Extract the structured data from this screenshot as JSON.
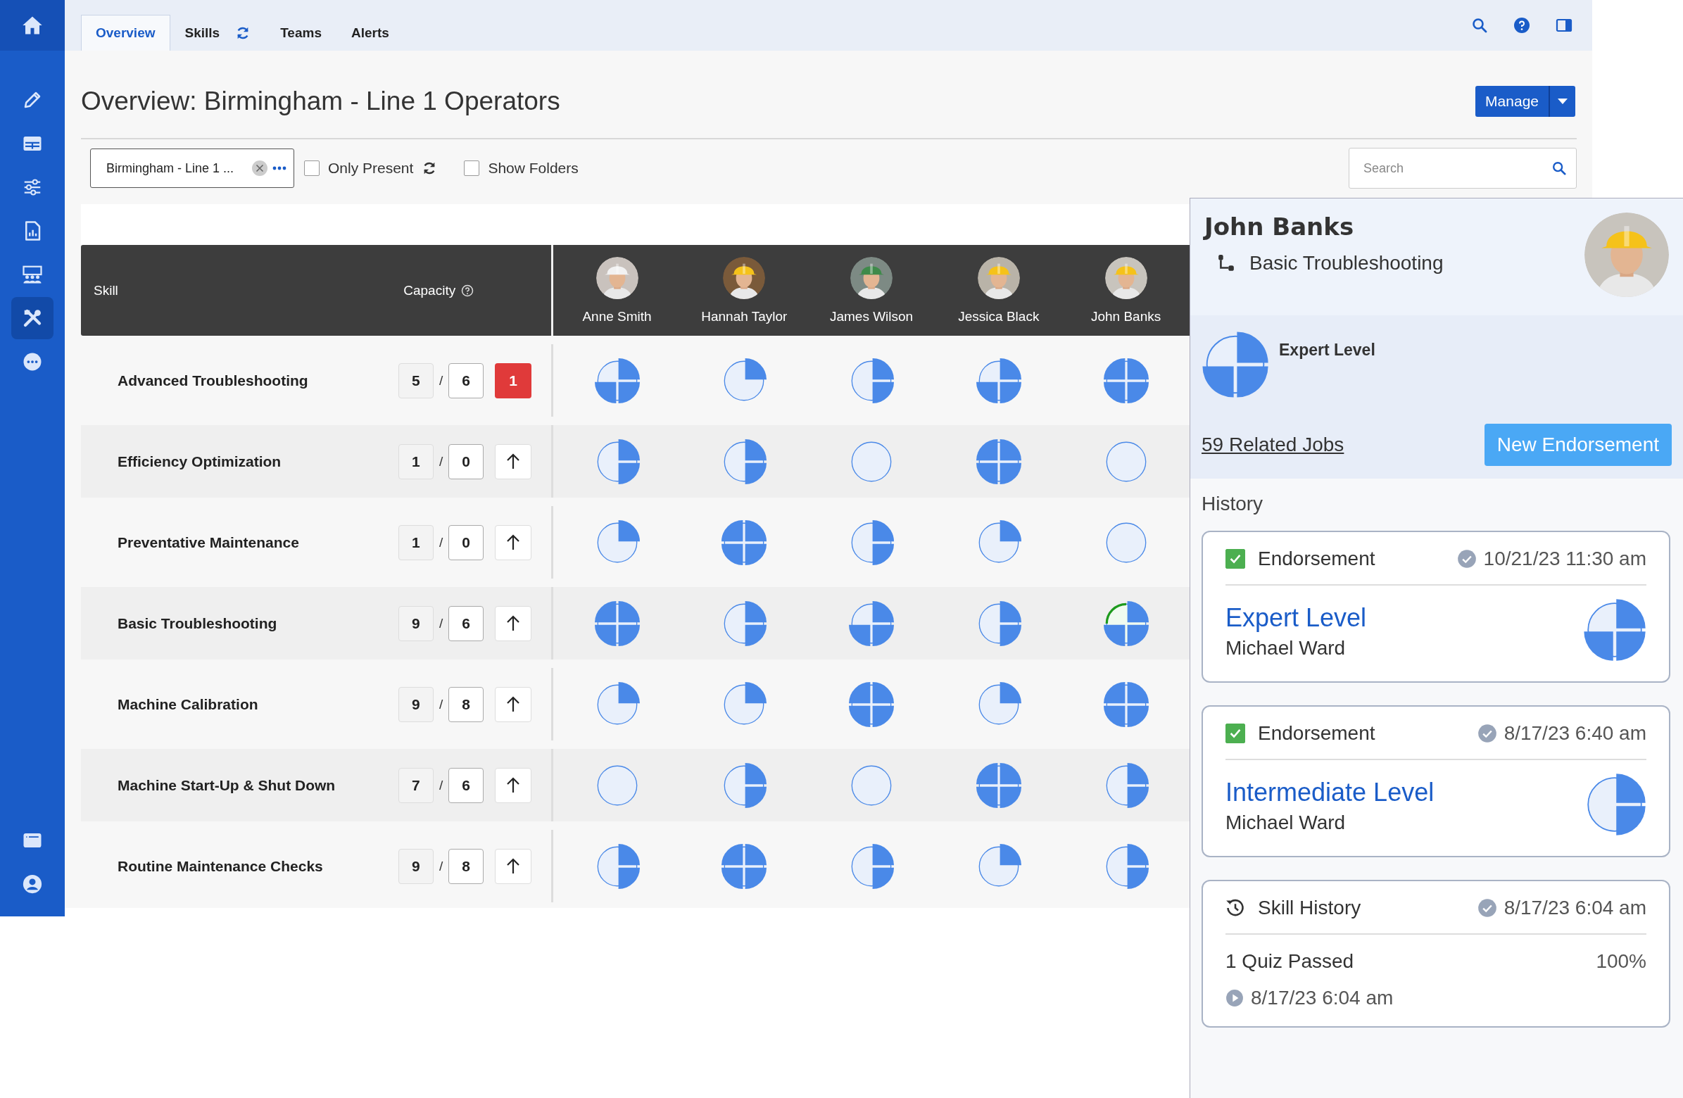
{
  "sidebar": {
    "items": [
      {
        "kind": "home",
        "selected": false
      },
      {
        "kind": "pencil",
        "selected": false
      },
      {
        "kind": "table",
        "selected": false
      },
      {
        "kind": "sliders",
        "selected": false
      },
      {
        "kind": "report",
        "selected": false
      },
      {
        "kind": "team",
        "selected": false
      },
      {
        "kind": "tools",
        "selected": true
      },
      {
        "kind": "chat",
        "selected": false
      },
      {
        "kind": "window",
        "selected": false
      },
      {
        "kind": "user",
        "selected": false
      }
    ]
  },
  "tabs": [
    {
      "label": "Overview",
      "selected": true,
      "refresh": false
    },
    {
      "label": "Skills",
      "selected": false,
      "refresh": true
    },
    {
      "label": "Teams",
      "selected": false,
      "refresh": false
    },
    {
      "label": "Alerts",
      "selected": false,
      "refresh": false
    }
  ],
  "page_title": "Overview: Birmingham - Line 1 Operators",
  "manage_button": {
    "label": "Manage"
  },
  "filters": {
    "group": {
      "value": "Birmingham - Line 1 ..."
    },
    "options": [
      {
        "label": "Only Present",
        "checked": false,
        "refresh": true
      },
      {
        "label": "Show Folders",
        "checked": false,
        "refresh": false
      }
    ],
    "search": {
      "placeholder": "Search"
    }
  },
  "table": {
    "columns": {
      "skill": "Skill",
      "capacity": "Capacity"
    },
    "people": [
      {
        "name": "Anne Smith"
      },
      {
        "name": "Hannah Taylor"
      },
      {
        "name": "James Wilson"
      },
      {
        "name": "Jessica Black"
      },
      {
        "name": "John Banks"
      }
    ],
    "rows": [
      {
        "skill": "Advanced Troubleshooting",
        "present": "5",
        "separator": "/",
        "required": "6",
        "action": {
          "kind": "alert",
          "count": "1"
        },
        "cells": [
          {
            "kind": "three_quarters",
            "pending": false
          },
          {
            "kind": "quarter",
            "pending": false
          },
          {
            "kind": "half",
            "pending": false
          },
          {
            "kind": "three_quarters",
            "pending": false
          },
          {
            "kind": "full",
            "pending": false
          }
        ]
      },
      {
        "skill": "Efficiency Optimization",
        "present": "1",
        "separator": "/",
        "required": "0",
        "action": {
          "kind": "raise"
        },
        "cells": [
          {
            "kind": "half",
            "pending": false
          },
          {
            "kind": "half",
            "pending": false
          },
          {
            "kind": "none",
            "pending": false
          },
          {
            "kind": "full",
            "pending": false
          },
          {
            "kind": "none",
            "pending": false
          }
        ]
      },
      {
        "skill": "Preventative Maintenance",
        "present": "1",
        "separator": "/",
        "required": "0",
        "action": {
          "kind": "raise"
        },
        "cells": [
          {
            "kind": "quarter",
            "pending": false
          },
          {
            "kind": "full",
            "pending": false
          },
          {
            "kind": "half",
            "pending": false
          },
          {
            "kind": "quarter",
            "pending": false
          },
          {
            "kind": "none",
            "pending": false
          }
        ]
      },
      {
        "skill": "Basic Troubleshooting",
        "present": "9",
        "separator": "/",
        "required": "6",
        "action": {
          "kind": "raise"
        },
        "cells": [
          {
            "kind": "full",
            "pending": false
          },
          {
            "kind": "half",
            "pending": false
          },
          {
            "kind": "three_quarters",
            "pending": false
          },
          {
            "kind": "half",
            "pending": false
          },
          {
            "kind": "three_quarters",
            "pending": true
          }
        ]
      },
      {
        "skill": "Machine Calibration",
        "present": "9",
        "separator": "/",
        "required": "8",
        "action": {
          "kind": "raise"
        },
        "cells": [
          {
            "kind": "quarter",
            "pending": false
          },
          {
            "kind": "quarter",
            "pending": false
          },
          {
            "kind": "full",
            "pending": false
          },
          {
            "kind": "quarter",
            "pending": false
          },
          {
            "kind": "full",
            "pending": false
          }
        ]
      },
      {
        "skill": "Machine Start-Up & Shut Down",
        "present": "7",
        "separator": "/",
        "required": "6",
        "action": {
          "kind": "raise"
        },
        "cells": [
          {
            "kind": "none",
            "pending": false
          },
          {
            "kind": "half",
            "pending": false
          },
          {
            "kind": "none",
            "pending": false
          },
          {
            "kind": "full",
            "pending": false
          },
          {
            "kind": "half",
            "pending": false
          }
        ]
      },
      {
        "skill": "Routine Maintenance Checks",
        "present": "9",
        "separator": "/",
        "required": "8",
        "action": {
          "kind": "raise"
        },
        "cells": [
          {
            "kind": "half",
            "pending": false
          },
          {
            "kind": "full",
            "pending": false
          },
          {
            "kind": "half",
            "pending": false
          },
          {
            "kind": "quarter",
            "pending": false
          },
          {
            "kind": "half",
            "pending": false
          }
        ]
      }
    ]
  },
  "panel": {
    "name": "John Banks",
    "skill": "Basic Troubleshooting",
    "pie": {
      "kind": "three_quarters"
    },
    "level_label": "Expert Level",
    "related_jobs": "59 Related Jobs",
    "endorse_button": "New Endorsement",
    "history_label": "History",
    "history": [
      {
        "kind": "endorsement",
        "checked": true,
        "title": "Endorsement",
        "time": "10/21/23 11:30 am",
        "level_name": "Expert Level",
        "by": "Michael Ward",
        "pie": {
          "kind": "three_quarters"
        }
      },
      {
        "kind": "endorsement",
        "checked": true,
        "title": "Endorsement",
        "time": "8/17/23 6:40 am",
        "level_name": "Intermediate Level",
        "by": "Michael Ward",
        "pie": {
          "kind": "half"
        }
      },
      {
        "kind": "skill_history",
        "title": "Skill History",
        "time": "8/17/23 6:04 am",
        "result": "1 Quiz Passed",
        "score": "100%",
        "date": "8/17/23 6:04 am"
      }
    ]
  }
}
